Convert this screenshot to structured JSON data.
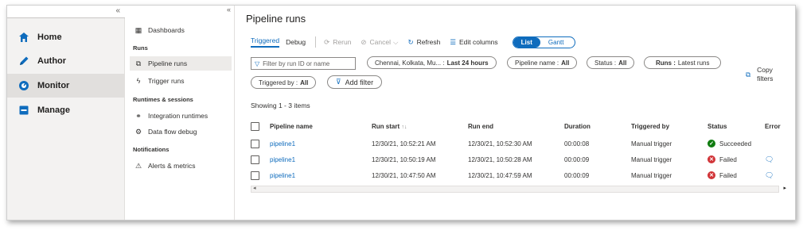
{
  "leftnav": {
    "collapse_icon": "«",
    "items": [
      {
        "label": "Home",
        "icon": "home-icon"
      },
      {
        "label": "Author",
        "icon": "pencil-icon"
      },
      {
        "label": "Monitor",
        "icon": "monitor-icon"
      },
      {
        "label": "Manage",
        "icon": "toolbox-icon"
      }
    ],
    "active": "Monitor"
  },
  "subnav": {
    "collapse_icon": "«",
    "dashboards": "Dashboards",
    "runs_heading": "Runs",
    "pipeline_runs": "Pipeline runs",
    "trigger_runs": "Trigger runs",
    "runtimes_heading": "Runtimes & sessions",
    "integration_runtimes": "Integration runtimes",
    "dataflow_debug": "Data flow debug",
    "notifications_heading": "Notifications",
    "alerts_metrics": "Alerts & metrics"
  },
  "main": {
    "title": "Pipeline runs",
    "toolbar": {
      "tab_triggered": "Triggered",
      "tab_debug": "Debug",
      "rerun": "Rerun",
      "cancel": "Cancel",
      "refresh": "Refresh",
      "edit_columns": "Edit columns",
      "view_list": "List",
      "view_gantt": "Gantt"
    },
    "filters": {
      "search_placeholder": "Filter by run ID or name",
      "region_prefix": "Chennai, Kolkata, Mu... :",
      "region_value": "Last 24 hours",
      "pipeline_name_prefix": "Pipeline name :",
      "pipeline_name_value": "All",
      "status_prefix": "Status :",
      "status_value": "All",
      "runs_prefix": "Runs :",
      "runs_value": "Latest runs",
      "triggered_by_prefix": "Triggered by :",
      "triggered_by_value": "All",
      "add_filter": "Add filter",
      "copy_filters": "Copy filters"
    },
    "showing": "Showing 1 - 3 items",
    "table": {
      "headers": [
        "Pipeline name",
        "Run start",
        "Run end",
        "Duration",
        "Triggered by",
        "Status",
        "Error"
      ],
      "sort_indicator": "↑↓",
      "rows": [
        {
          "name": "pipeline1",
          "start": "12/30/21, 10:52:21 AM",
          "end": "12/30/21, 10:52:30 AM",
          "duration": "00:00:08",
          "triggered_by": "Manual trigger",
          "status": "Succeeded",
          "error": ""
        },
        {
          "name": "pipeline1",
          "start": "12/30/21, 10:50:19 AM",
          "end": "12/30/21, 10:50:28 AM",
          "duration": "00:00:09",
          "triggered_by": "Manual trigger",
          "status": "Failed",
          "error": "message-icon"
        },
        {
          "name": "pipeline1",
          "start": "12/30/21, 10:47:50 AM",
          "end": "12/30/21, 10:47:59 AM",
          "duration": "00:00:09",
          "triggered_by": "Manual trigger",
          "status": "Failed",
          "error": "message-icon"
        }
      ]
    }
  },
  "colors": {
    "accent": "#0f6cbd",
    "success": "#107c10",
    "failure": "#d13438"
  }
}
